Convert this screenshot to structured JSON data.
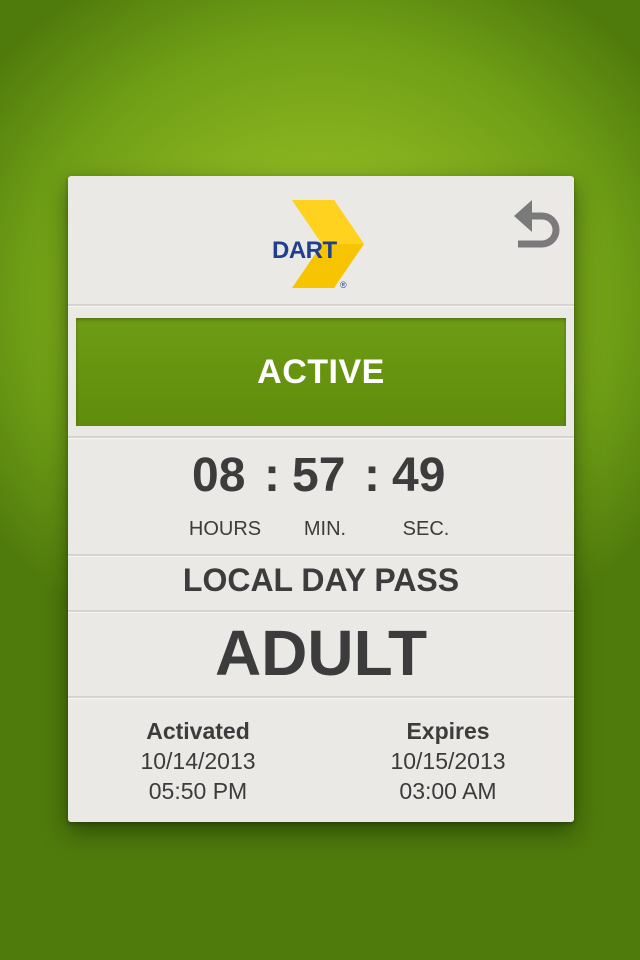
{
  "logo": {
    "text": "DART",
    "registered": "®",
    "brand_blue": "#1f3f8f",
    "brand_yellow": "#f6c400"
  },
  "header": {
    "back_icon": "undo-arrow-icon"
  },
  "status": {
    "label": "ACTIVE",
    "color": "#6a9712"
  },
  "timer": {
    "hours": "08",
    "minutes": "57",
    "seconds": "49",
    "separator": ":",
    "hours_label": "HOURS",
    "minutes_label": "MIN.",
    "seconds_label": "SEC."
  },
  "pass": {
    "name": "LOCAL DAY PASS",
    "rider_type": "ADULT"
  },
  "activated": {
    "label": "Activated",
    "date": "10/14/2013",
    "time": "05:50 PM"
  },
  "expires": {
    "label": "Expires",
    "date": "10/15/2013",
    "time": "03:00 AM"
  }
}
